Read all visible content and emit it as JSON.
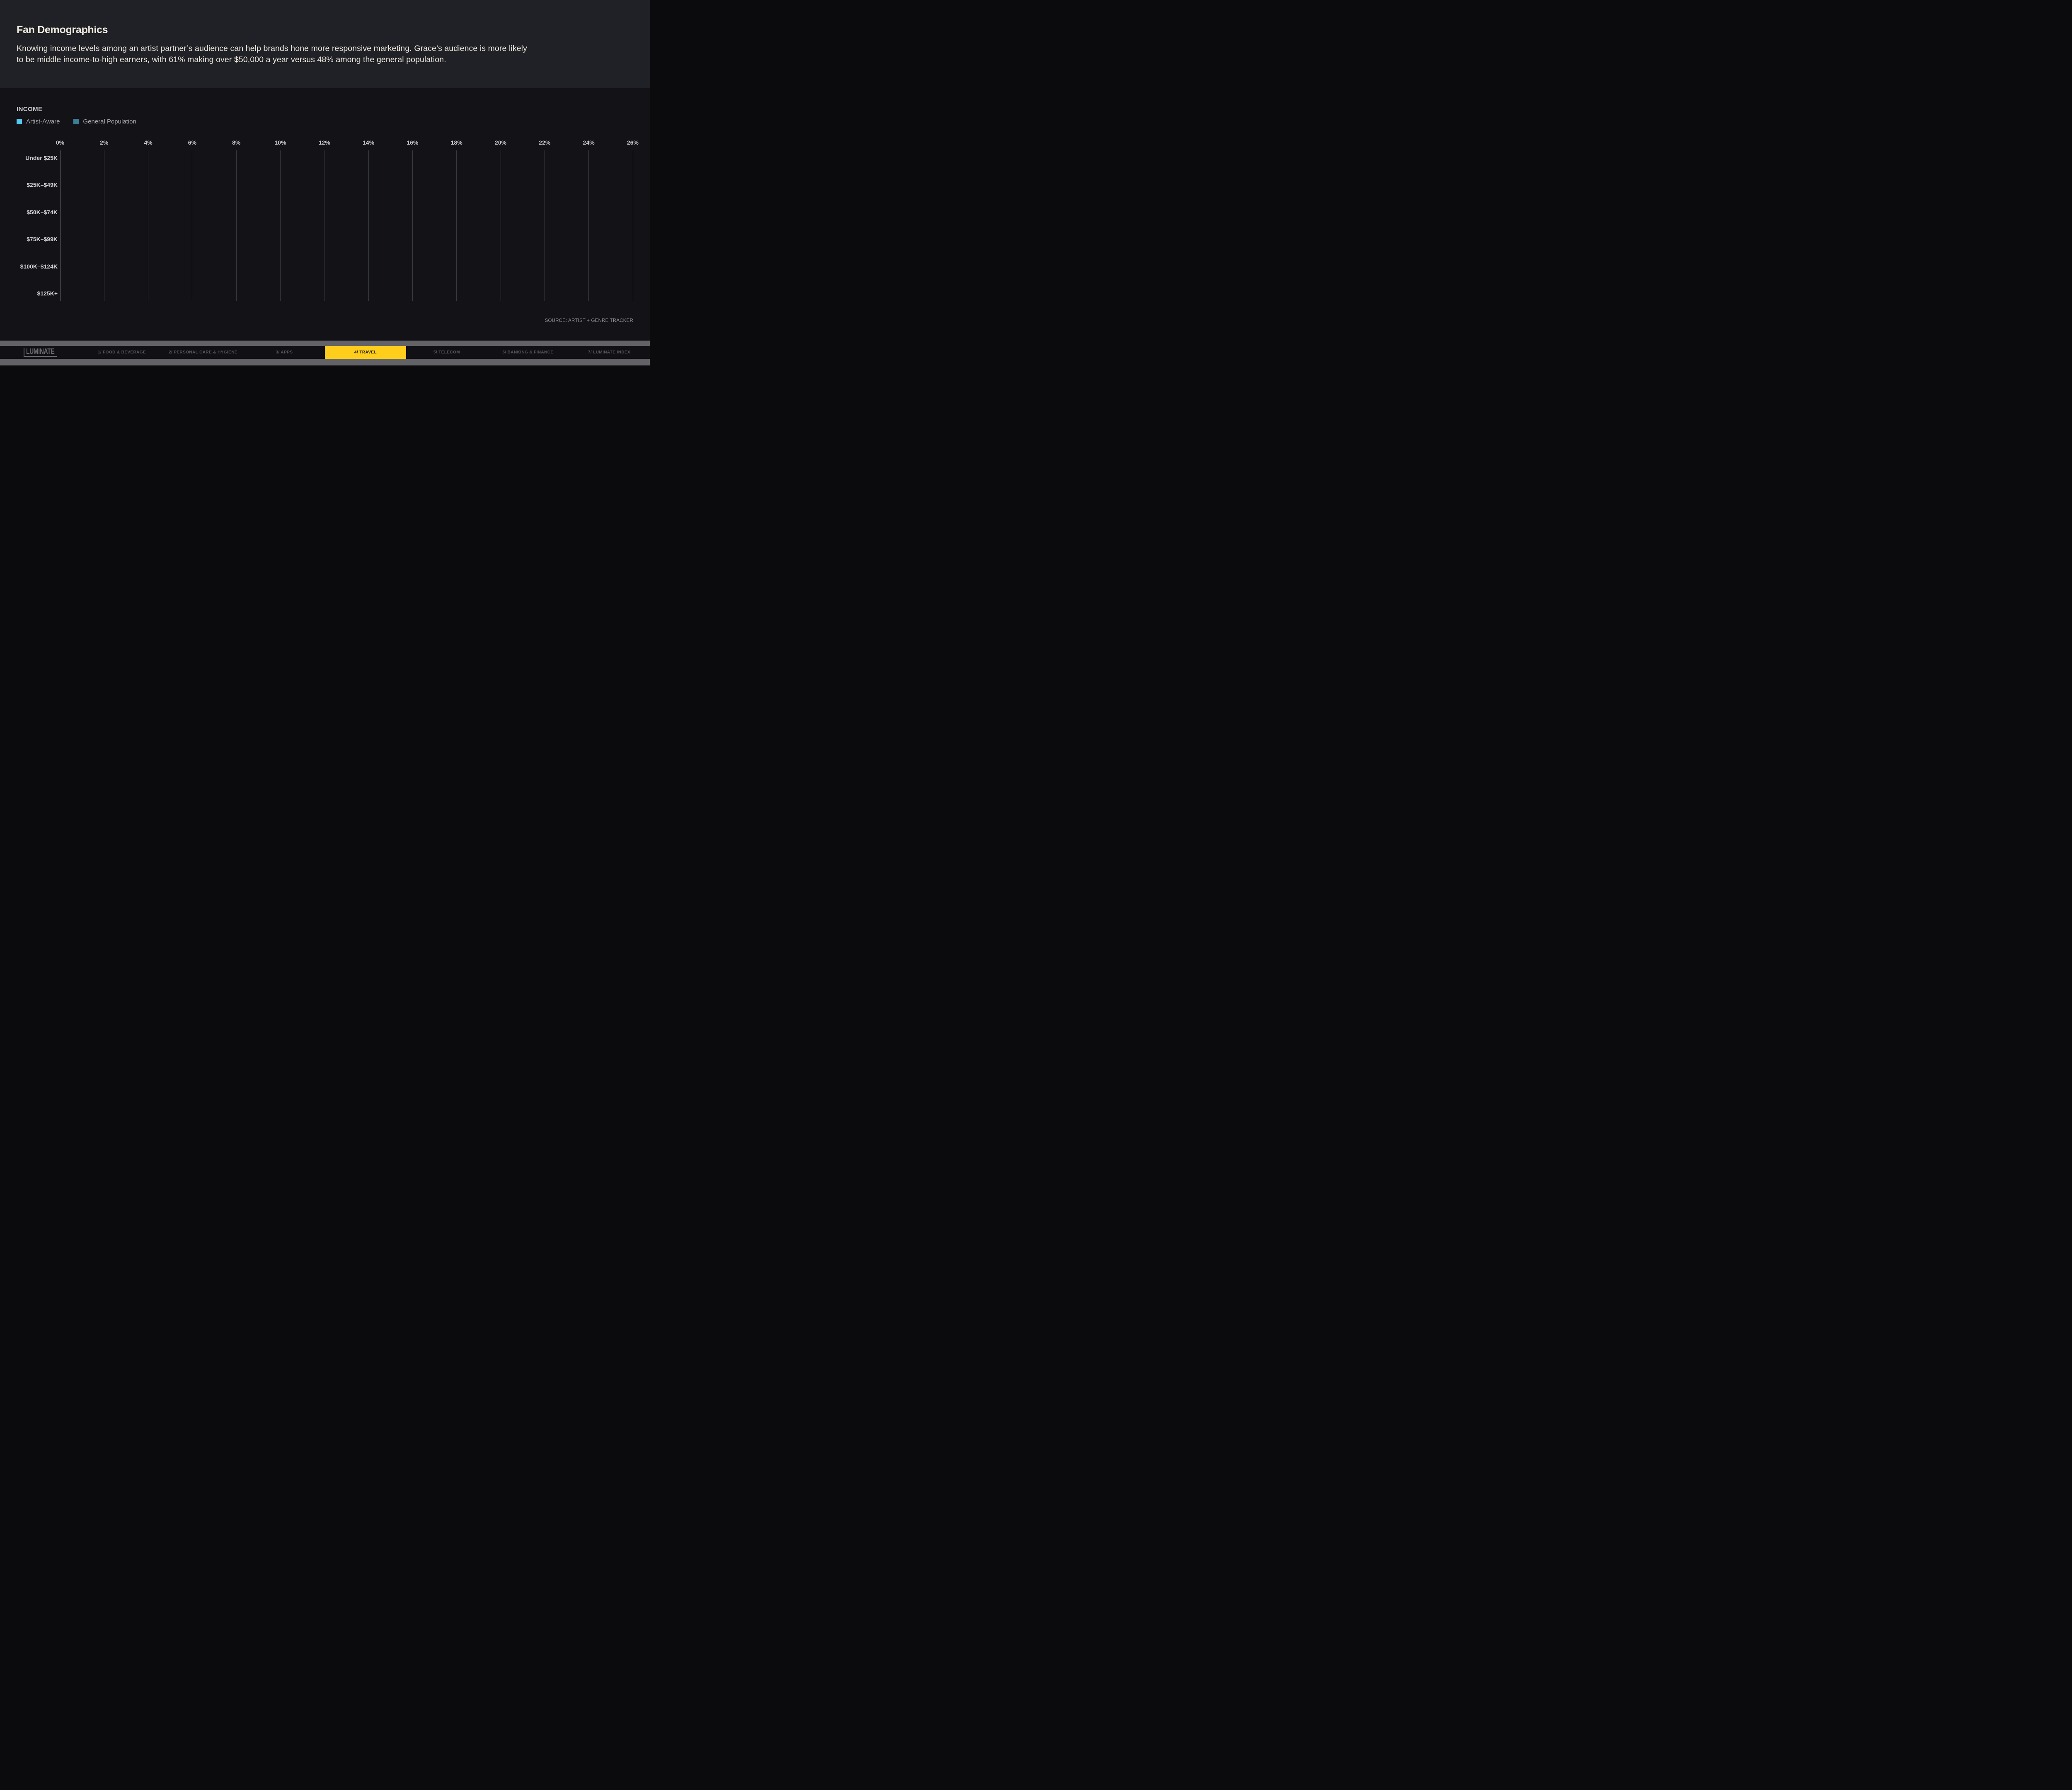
{
  "header": {
    "title": "Fan Demographics",
    "description_line1": "Knowing income levels among an artist partner’s audience can help brands hone more responsive marketing. Grace’s audience is more likely",
    "description_line2": "to be middle income-to-high earners, with 61% making over $50,000 a year versus 48% among the general population."
  },
  "chart_data": {
    "type": "bar",
    "orientation": "horizontal",
    "title": "INCOME",
    "categories": [
      "Under $25K",
      "$25K–$49K",
      "$50K–$74K",
      "$75K–$99K",
      "$100K–$124K",
      "$125K+"
    ],
    "series": [
      {
        "name": "Artist-Aware",
        "color": "#57c9f0",
        "values": []
      },
      {
        "name": "General Population",
        "color": "#3a7e98",
        "values": []
      }
    ],
    "bars_rendered": false,
    "x_axis": {
      "unit": "%",
      "min": 0,
      "max": 26,
      "tick_step": 2,
      "ticks": [
        "0%",
        "2%",
        "4%",
        "6%",
        "8%",
        "10%",
        "12%",
        "14%",
        "16%",
        "18%",
        "20%",
        "22%",
        "24%",
        "26%"
      ]
    },
    "grid": true,
    "legend_position": "top-left"
  },
  "chart": {
    "source": "SOURCE: ARTIST + GENRE TRACKER"
  },
  "footer": {
    "logo": "LUMINATE",
    "active_tab_index": 3,
    "active_color": "#ffce1c",
    "tabs": [
      {
        "label": "1/ FOOD & BEVERAGE"
      },
      {
        "label": "2/ PERSONAL CARE & HYGIENE"
      },
      {
        "label": "3/ APPS"
      },
      {
        "label": "4/ TRAVEL"
      },
      {
        "label": "5/ TELECOM"
      },
      {
        "label": "6/ BANKING & FINANCE"
      },
      {
        "label": "7/ LUMINATE INDEX"
      }
    ]
  },
  "colors": {
    "header_background": "#1f2127",
    "chart_background": "#121217",
    "gridline": "#3a3b41",
    "axis_line": "#5d5e66",
    "footer_bar": "#626267",
    "nav_strip": "#111115",
    "title_text": "#f0ebdd"
  }
}
